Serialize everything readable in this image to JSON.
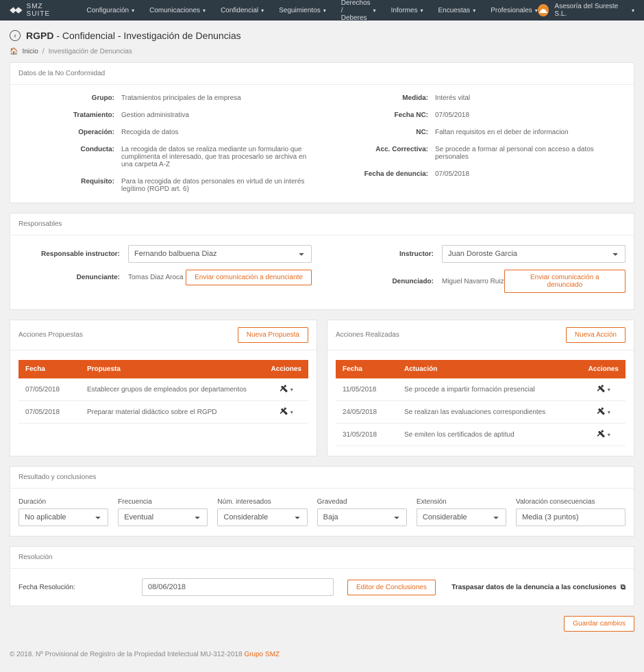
{
  "brand": "SMZ SUITE",
  "menus": [
    "Configuración",
    "Comunicaciones",
    "Confidencial",
    "Seguimientos",
    "Derechos / Deberes",
    "Informes",
    "Encuestas",
    "Profesionales"
  ],
  "account": "Asesoría del Sureste S.L.",
  "title": {
    "bold": "RGPD",
    "rest": " - Confidencial - Investigación de Denuncias"
  },
  "crumbs": {
    "home": "Inicio",
    "sep": "/",
    "current": "Investigación de Denuncias"
  },
  "datosNC": {
    "header": "Datos de la No Conformidad",
    "left": [
      {
        "k": "Grupo:",
        "v": "Tratamientos principales de la empresa"
      },
      {
        "k": "Tratamiento:",
        "v": "Gestion administrativa"
      },
      {
        "k": "Operación:",
        "v": "Recogida de datos"
      },
      {
        "k": "Conducta:",
        "v": "La recogida de datos se realiza mediante un formulario que cumplimenta el interesado, que tras procesarlo se archiva en una carpeta A-Z"
      },
      {
        "k": "Requisito:",
        "v": "Para la recogida de datos personales en virtud de un interés legítimo (RGPD art. 6)"
      }
    ],
    "right": [
      {
        "k": "Medida:",
        "v": "Interés vital"
      },
      {
        "k": "Fecha NC:",
        "v": "07/05/2018"
      },
      {
        "k": "NC:",
        "v": "Faltan requisitos en el deber de informacion"
      },
      {
        "k": "Acc. Correctiva:",
        "v": "Se procede a formar al personal con acceso a datos personales"
      },
      {
        "k": "Fecha de denuncia:",
        "v": "07/05/2018"
      }
    ]
  },
  "resp": {
    "header": "Responsables",
    "respInstrLabel": "Responsable instructor:",
    "respInstrValue": "Fernando balbuena Diaz",
    "instrLabel": "Instructor:",
    "instrValue": "Juan Doroste Garcia",
    "denuncianteLabel": "Denunciante:",
    "denuncianteValue": "Tomas Diaz Aroca",
    "denunciadoLabel": "Denunciado:",
    "denunciadoValue": "Miguel Navarro Ruiz",
    "btnDenunciante": "Enviar comunicación a denunciante",
    "btnDenunciado": "Enviar comunicación a denunciado"
  },
  "propuestas": {
    "header": "Acciones Propuestas",
    "newBtn": "Nueva Propuesta",
    "cols": [
      "Fecha",
      "Propuesta",
      "Acciones"
    ],
    "rows": [
      {
        "fecha": "07/05/2018",
        "txt": "Establecer grupos de empleados por departamentos"
      },
      {
        "fecha": "07/05/2018",
        "txt": "Preparar material didáctico sobre el RGPD"
      }
    ]
  },
  "realizadas": {
    "header": "Acciones Realizadas",
    "newBtn": "Nueva Acción",
    "cols": [
      "Fecha",
      "Actuación",
      "Acciones"
    ],
    "rows": [
      {
        "fecha": "11/05/2018",
        "txt": "Se procede a impartir formación presencial"
      },
      {
        "fecha": "24/05/2018",
        "txt": "Se realizan las evaluaciones correspondientes"
      },
      {
        "fecha": "31/05/2018",
        "txt": "Se emiten los certificados de aptitud"
      }
    ]
  },
  "resultado": {
    "header": "Resultado y conclusiones",
    "fields": {
      "duracion": {
        "label": "Duración",
        "value": "No aplicable"
      },
      "frecuencia": {
        "label": "Frecuencia",
        "value": "Eventual"
      },
      "interesados": {
        "label": "Núm. interesados",
        "value": "Considerable"
      },
      "gravedad": {
        "label": "Gravedad",
        "value": "Baja"
      },
      "extension": {
        "label": "Extensión",
        "value": "Considerable"
      },
      "valoracion": {
        "label": "Valoración consecuencias",
        "value": "Media (3 puntos)"
      }
    }
  },
  "resolucion": {
    "header": "Resolución",
    "fechaLabel": "Fecha Resolución:",
    "fechaValue": "08/06/2018",
    "editorBtn": "Editor de Conclusiones",
    "traspasar": "Traspasar datos de la denuncia a las conclusiones"
  },
  "save": "Guardar cambios",
  "footer": {
    "text": "© 2018. Nº Provisional de Registro de la Propiedad Intelectual MU-312-2018 ",
    "link": "Grupo SMZ"
  }
}
